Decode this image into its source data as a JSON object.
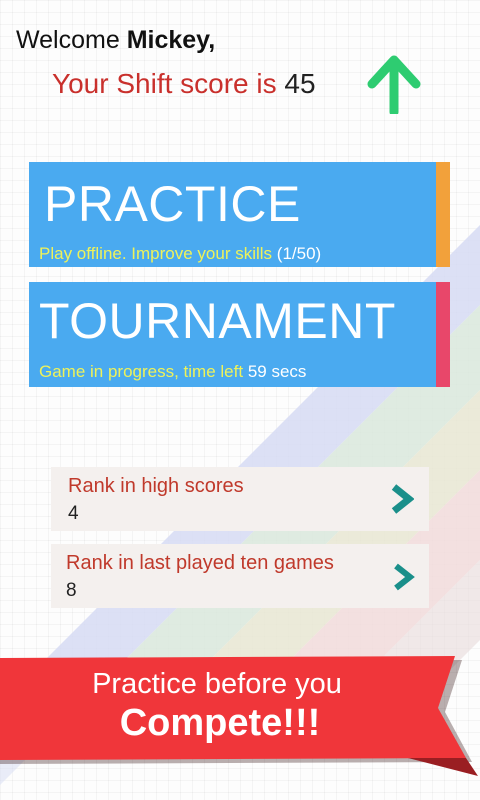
{
  "header": {
    "welcome_prefix": "Welcome",
    "user_name": "Mickey,",
    "score_label": "Your Shift score is",
    "score_value": "45",
    "trend_icon": "arrow-up-icon",
    "trend_color": "#2ecc71"
  },
  "modes": {
    "practice": {
      "title": "PRACTICE",
      "subtitle": "Play offline. Improve your skills",
      "progress": "(1/50)",
      "accent": "#f2a13b"
    },
    "tournament": {
      "title": "TOURNAMENT",
      "subtitle": "Game in progress, time left",
      "time_left": "59 secs",
      "accent": "#e8476a"
    }
  },
  "ranks": [
    {
      "label": "Rank in high scores",
      "value": "4",
      "icon": "chevron-right-icon"
    },
    {
      "label": "Rank in last played ten games",
      "value": "8",
      "icon": "chevron-right-icon"
    }
  ],
  "banner": {
    "line1": "Practice before you",
    "line2": "Compete!!!",
    "color": "#f0363a"
  },
  "colors": {
    "card_blue": "#4aaaf0",
    "highlight_text": "#eef25a",
    "rank_label": "#c0392b",
    "chevron": "#1a8f8a"
  }
}
